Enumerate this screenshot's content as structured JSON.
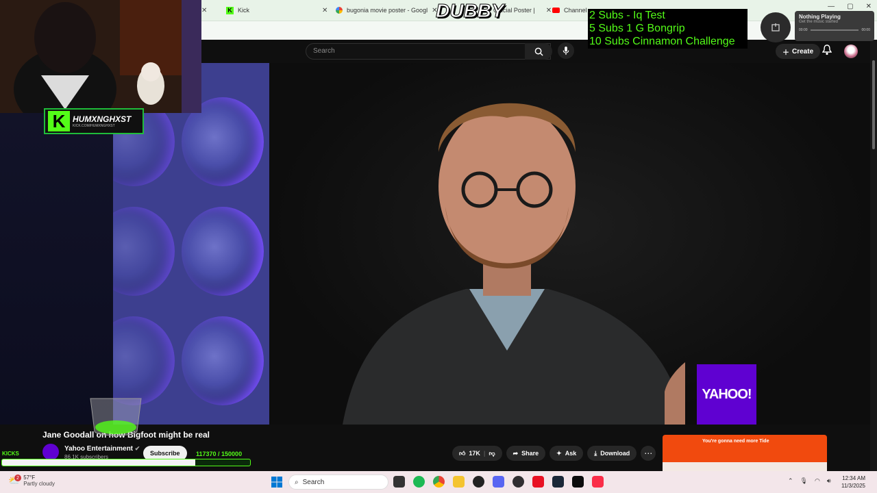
{
  "browser": {
    "tabs": [
      {
        "label": "Kick"
      },
      {
        "label": "bugonia movie poster - Googl"
      },
      {
        "label": "Official Poster |"
      },
      {
        "label": "Channel co"
      }
    ]
  },
  "youtube": {
    "search_placeholder": "Search",
    "create_label": "Create",
    "video": {
      "title": "Jane Goodall on how Bigfoot might be real",
      "channel": "Yahoo Entertainment",
      "subscribers": "86.1K subscribers",
      "subscribe_label": "Subscribe",
      "likes": "17K",
      "share_label": "Share",
      "ask_label": "Ask",
      "download_label": "Download",
      "watermark": "YAHOO!"
    }
  },
  "overlay": {
    "streamer_name": "HUMXNGHXST",
    "streamer_url": "KICK.COM/HUMXNGHXST",
    "dubby": "DUBBY",
    "goals": [
      "2 Subs - Iq Test",
      "5 Subs 1 G Bongrip",
      "10 Subs Cinnamon Challenge"
    ],
    "kicks_label": "KICKS",
    "sub_count": "117370  / 150000",
    "sub_progress_fraction": 0.78
  },
  "now_playing": {
    "title": "Nothing Playing",
    "subtitle": "Get the music started",
    "time_start": "00:00",
    "time_end": "00:00"
  },
  "ad": {
    "headline": "You're gonna need more Tide"
  },
  "taskbar": {
    "weather_temp": "57°F",
    "weather_desc": "Partly cloudy",
    "notif_count": "2",
    "search_label": "Search",
    "time": "12:34 AM",
    "date": "11/3/2025"
  },
  "colors": {
    "kick_green": "#53fc18",
    "yahoo_purple": "#5f01d1",
    "tide_orange": "#f14a0e"
  }
}
